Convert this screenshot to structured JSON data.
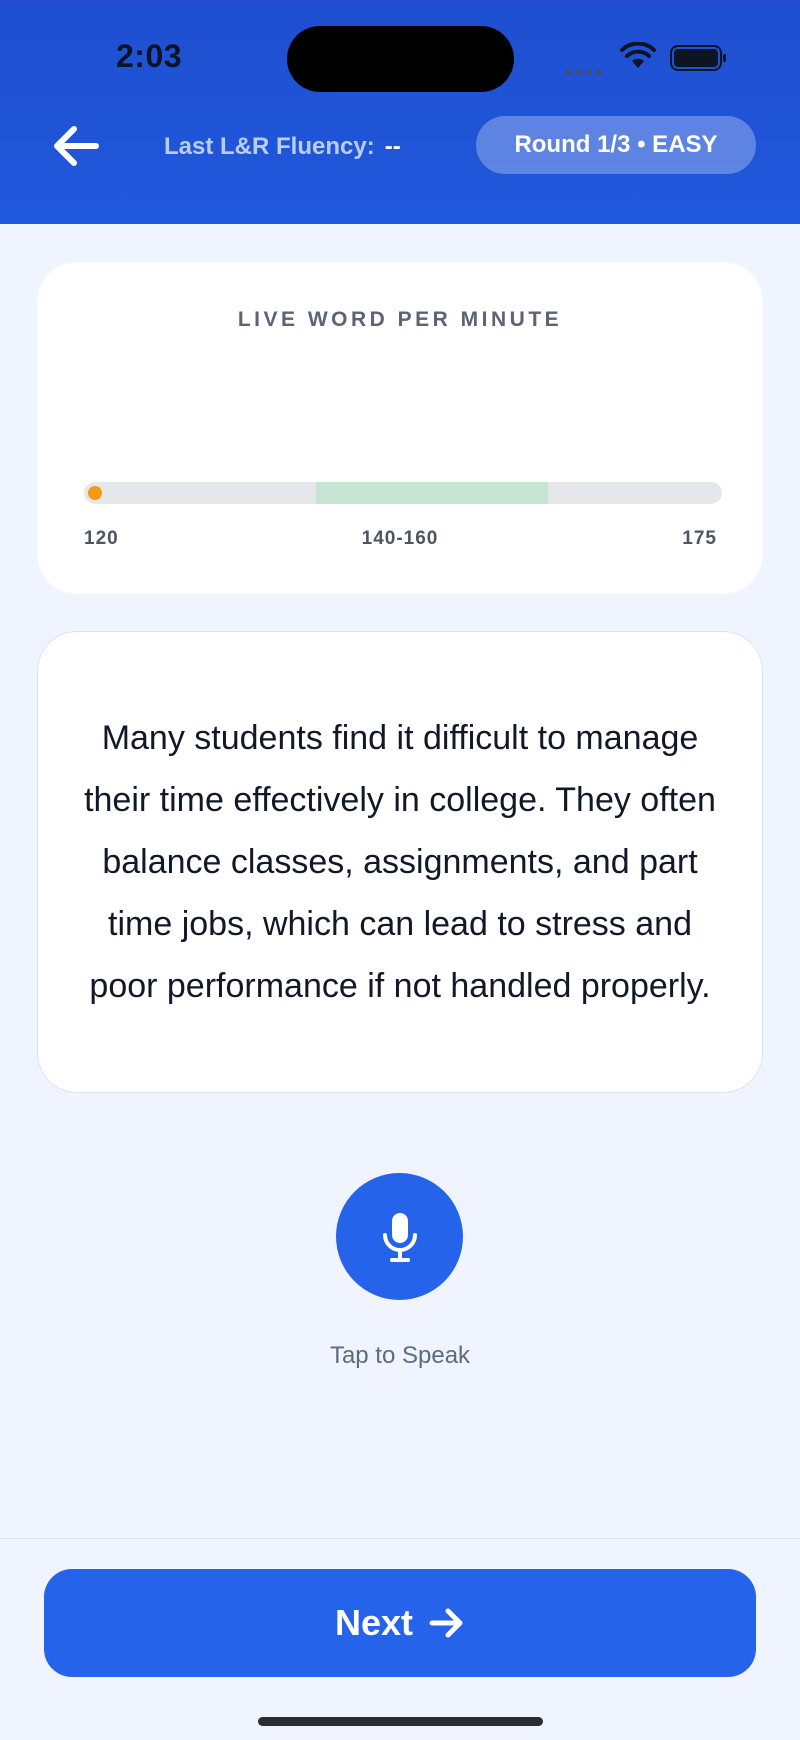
{
  "status_bar": {
    "time": "2:03"
  },
  "header": {
    "fluency_label": "Last L&R Fluency:",
    "fluency_value": "--",
    "round_badge": "Round 1/3 • EASY"
  },
  "wpm_meter": {
    "title": "LIVE WORD PER MINUTE",
    "min_label": "120",
    "target_label": "140-160",
    "max_label": "175",
    "scale_min": 120,
    "scale_max": 175,
    "target_min": 140,
    "target_max": 160,
    "current_wpm": 120,
    "colors": {
      "track": "#e6e7ea",
      "target": "#c6e6d3",
      "indicator": "#f39a12"
    }
  },
  "passage": {
    "text": "Many students find it difficult to manage their time effectively in college. They often balance classes, assignments, and part time jobs, which can lead to stress and poor performance if not handled properly."
  },
  "mic": {
    "label": "Tap to Speak",
    "icon": "microphone-icon"
  },
  "footer": {
    "next_label": "Next",
    "next_icon": "arrow-right-icon"
  },
  "colors": {
    "primary": "#2563eb",
    "header": "#1f4fd0",
    "background": "#eff4fe"
  }
}
